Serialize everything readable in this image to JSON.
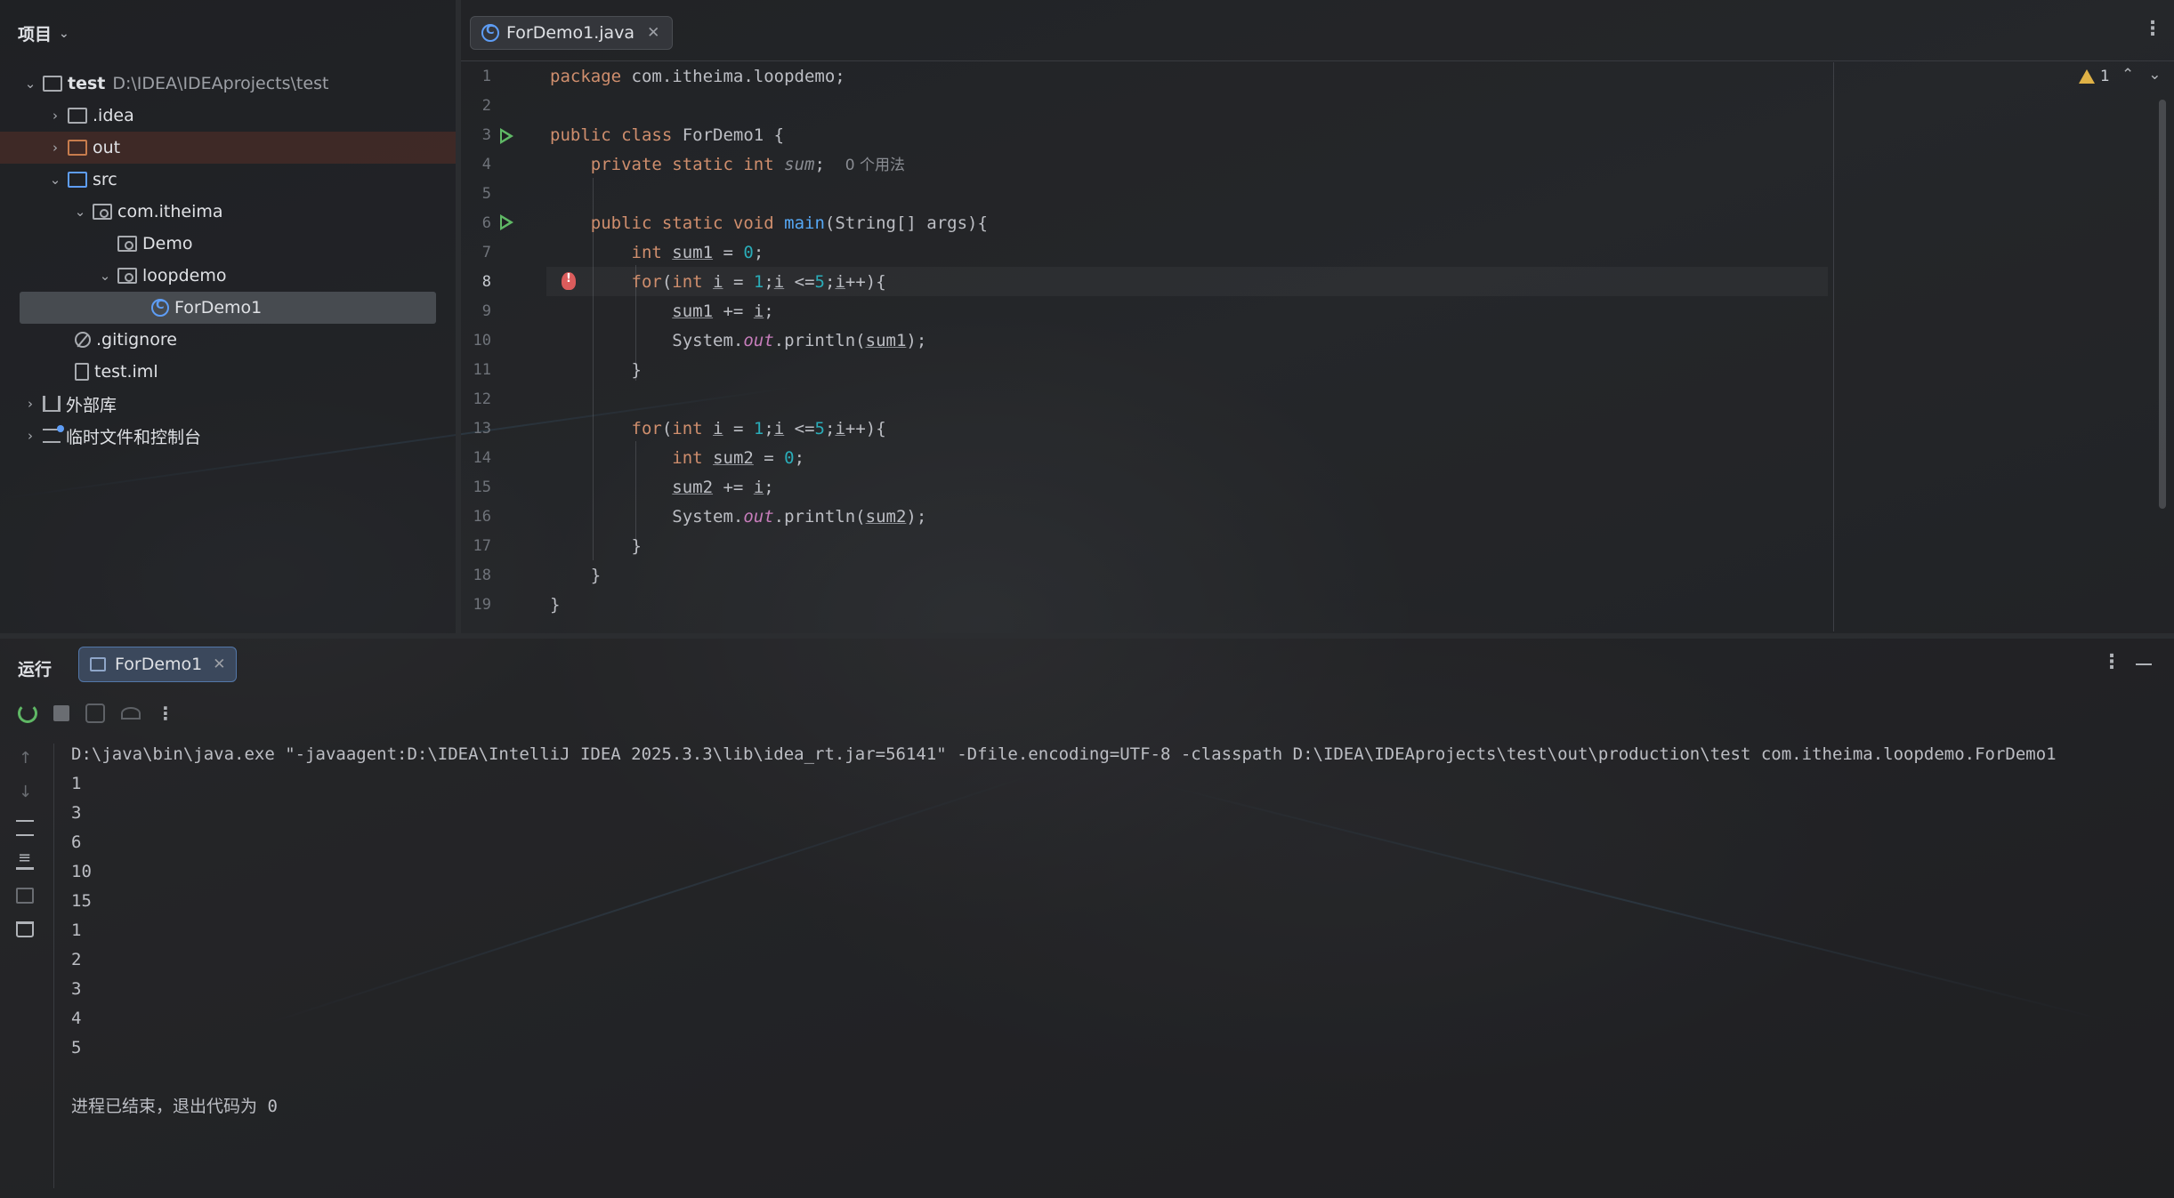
{
  "project_panel": {
    "title": "项目",
    "tree": [
      {
        "label": "test",
        "path": "D:\\IDEA\\IDEAprojects\\test"
      },
      {
        "label": ".idea"
      },
      {
        "label": "out"
      },
      {
        "label": "src"
      },
      {
        "label": "com.itheima"
      },
      {
        "label": "Demo"
      },
      {
        "label": "loopdemo"
      },
      {
        "label": "ForDemo1"
      },
      {
        "label": ".gitignore"
      },
      {
        "label": "test.iml"
      },
      {
        "label": "外部库"
      },
      {
        "label": "临时文件和控制台"
      }
    ]
  },
  "editor": {
    "tab_label": "ForDemo1.java",
    "warning_count": "1",
    "line_numbers": [
      "1",
      "2",
      "3",
      "4",
      "5",
      "6",
      "7",
      "8",
      "9",
      "10",
      "11",
      "12",
      "13",
      "14",
      "15",
      "16",
      "17",
      "18",
      "19"
    ],
    "inlay_hint": "0 个用法"
  },
  "run_panel": {
    "title": "运行",
    "tab_label": "ForDemo1",
    "command": "D:\\java\\bin\\java.exe \"-javaagent:D:\\IDEA\\IntelliJ IDEA 2025.3.3\\lib\\idea_rt.jar=56141\" -Dfile.encoding=UTF-8 -classpath D:\\IDEA\\IDEAprojects\\test\\out\\production\\test com.itheima.loopdemo.ForDemo1",
    "output": [
      "1",
      "3",
      "6",
      "10",
      "15",
      "1",
      "2",
      "3",
      "4",
      "5"
    ],
    "exit_message": "进程已结束，退出代码为 0"
  }
}
